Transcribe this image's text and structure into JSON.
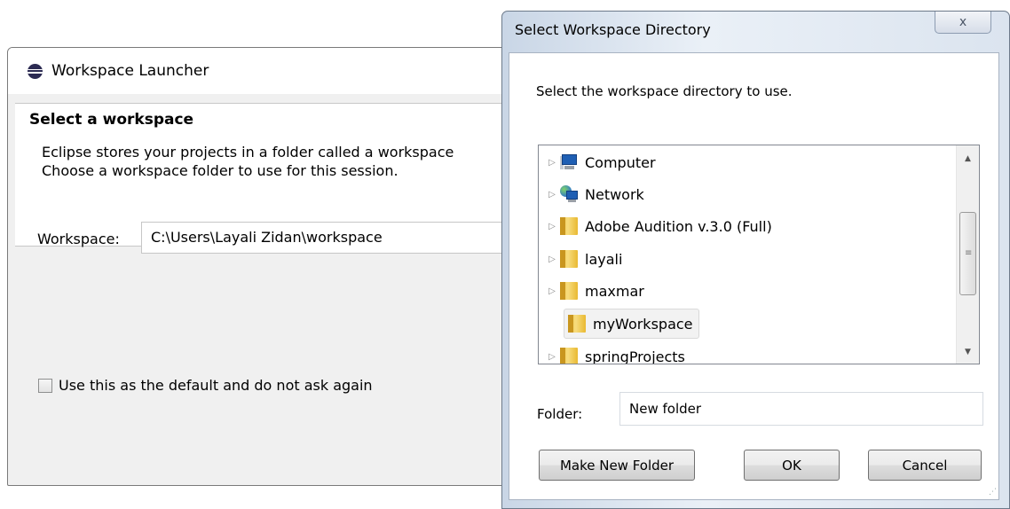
{
  "launcher": {
    "title": "Workspace Launcher",
    "header_title": "Select a workspace",
    "desc_line1": "Eclipse stores your projects in a folder called a workspace",
    "desc_line2": "Choose a workspace folder to use for this session.",
    "workspace_label": "Workspace:",
    "workspace_value": "C:\\Users\\Layali Zidan\\workspace",
    "default_checkbox_label": "Use this as the default and do not ask again",
    "default_checked": false
  },
  "dialog": {
    "title": "Select Workspace Directory",
    "close_glyph": "ⅹ",
    "message": "Select the workspace directory to use.",
    "tree": [
      {
        "label": "Computer",
        "icon": "computer-icon",
        "expandable": true,
        "selected": false
      },
      {
        "label": "Network",
        "icon": "network-icon",
        "expandable": true,
        "selected": false
      },
      {
        "label": "Adobe Audition v.3.0 (Full)",
        "icon": "folder-icon",
        "expandable": true,
        "selected": false
      },
      {
        "label": "layali",
        "icon": "folder-icon",
        "expandable": true,
        "selected": false
      },
      {
        "label": "maxmar",
        "icon": "folder-icon",
        "expandable": true,
        "selected": false
      },
      {
        "label": "myWorkspace",
        "icon": "folder-icon",
        "expandable": false,
        "selected": true
      },
      {
        "label": "springProjects",
        "icon": "folder-icon",
        "expandable": true,
        "selected": false
      }
    ],
    "folder_label": "Folder:",
    "folder_value": "New folder",
    "make_new_folder_label": "Make New Folder",
    "ok_label": "OK",
    "cancel_label": "Cancel"
  }
}
